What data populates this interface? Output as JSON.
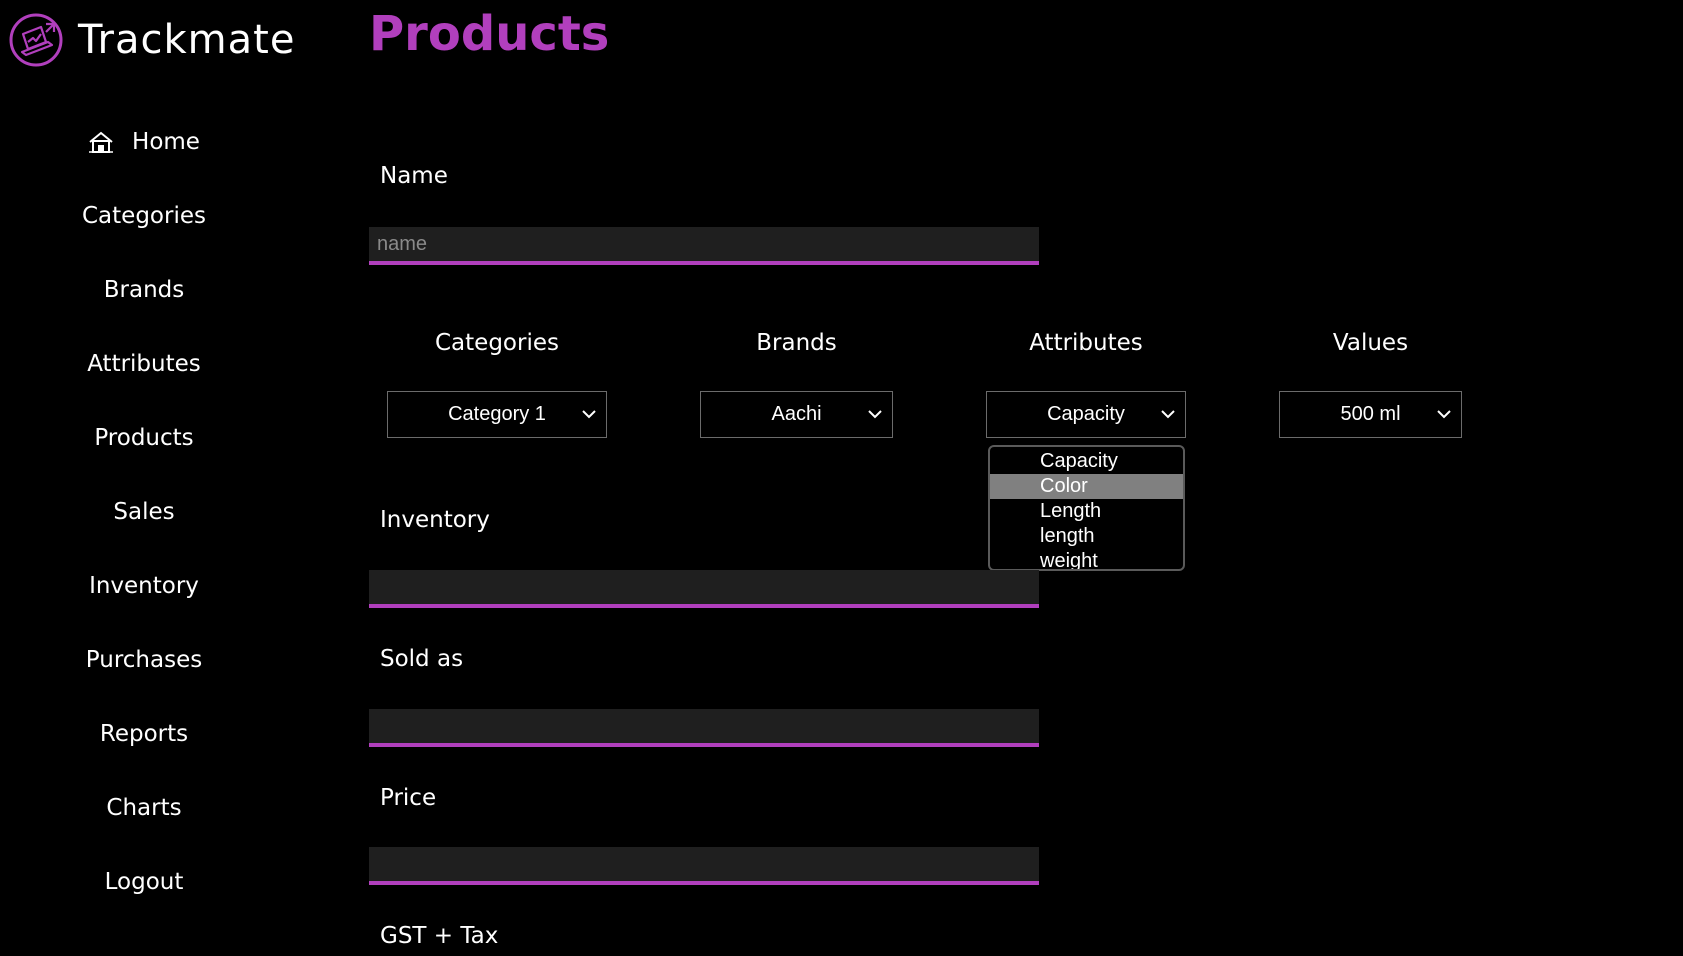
{
  "app": {
    "name": "Trackmate",
    "accent_color": "#b13fbd",
    "logo_icon": "laptop-chart-logo"
  },
  "sidebar": {
    "items": [
      {
        "label": "Home",
        "icon": "home-icon"
      },
      {
        "label": "Categories"
      },
      {
        "label": "Brands"
      },
      {
        "label": "Attributes"
      },
      {
        "label": "Products"
      },
      {
        "label": "Sales"
      },
      {
        "label": "Inventory"
      },
      {
        "label": "Purchases"
      },
      {
        "label": "Reports"
      },
      {
        "label": "Charts"
      },
      {
        "label": "Logout"
      }
    ]
  },
  "main": {
    "title": "Products",
    "name_field": {
      "label": "Name",
      "placeholder": "name",
      "value": ""
    },
    "selectors": {
      "categories": {
        "label": "Categories",
        "value": "Category 1"
      },
      "brands": {
        "label": "Brands",
        "value": "Aachi"
      },
      "attributes": {
        "label": "Attributes",
        "value": "Capacity",
        "options": [
          "Capacity",
          "Color",
          "Length",
          "length",
          "weight"
        ],
        "highlighted": "Color"
      },
      "values": {
        "label": "Values",
        "value": "500 ml"
      }
    },
    "inventory_field": {
      "label": "Inventory",
      "value": ""
    },
    "sold_as_field": {
      "label": "Sold as",
      "value": ""
    },
    "price_field": {
      "label": "Price",
      "value": ""
    },
    "gst_field": {
      "label": "GST + Tax"
    }
  }
}
